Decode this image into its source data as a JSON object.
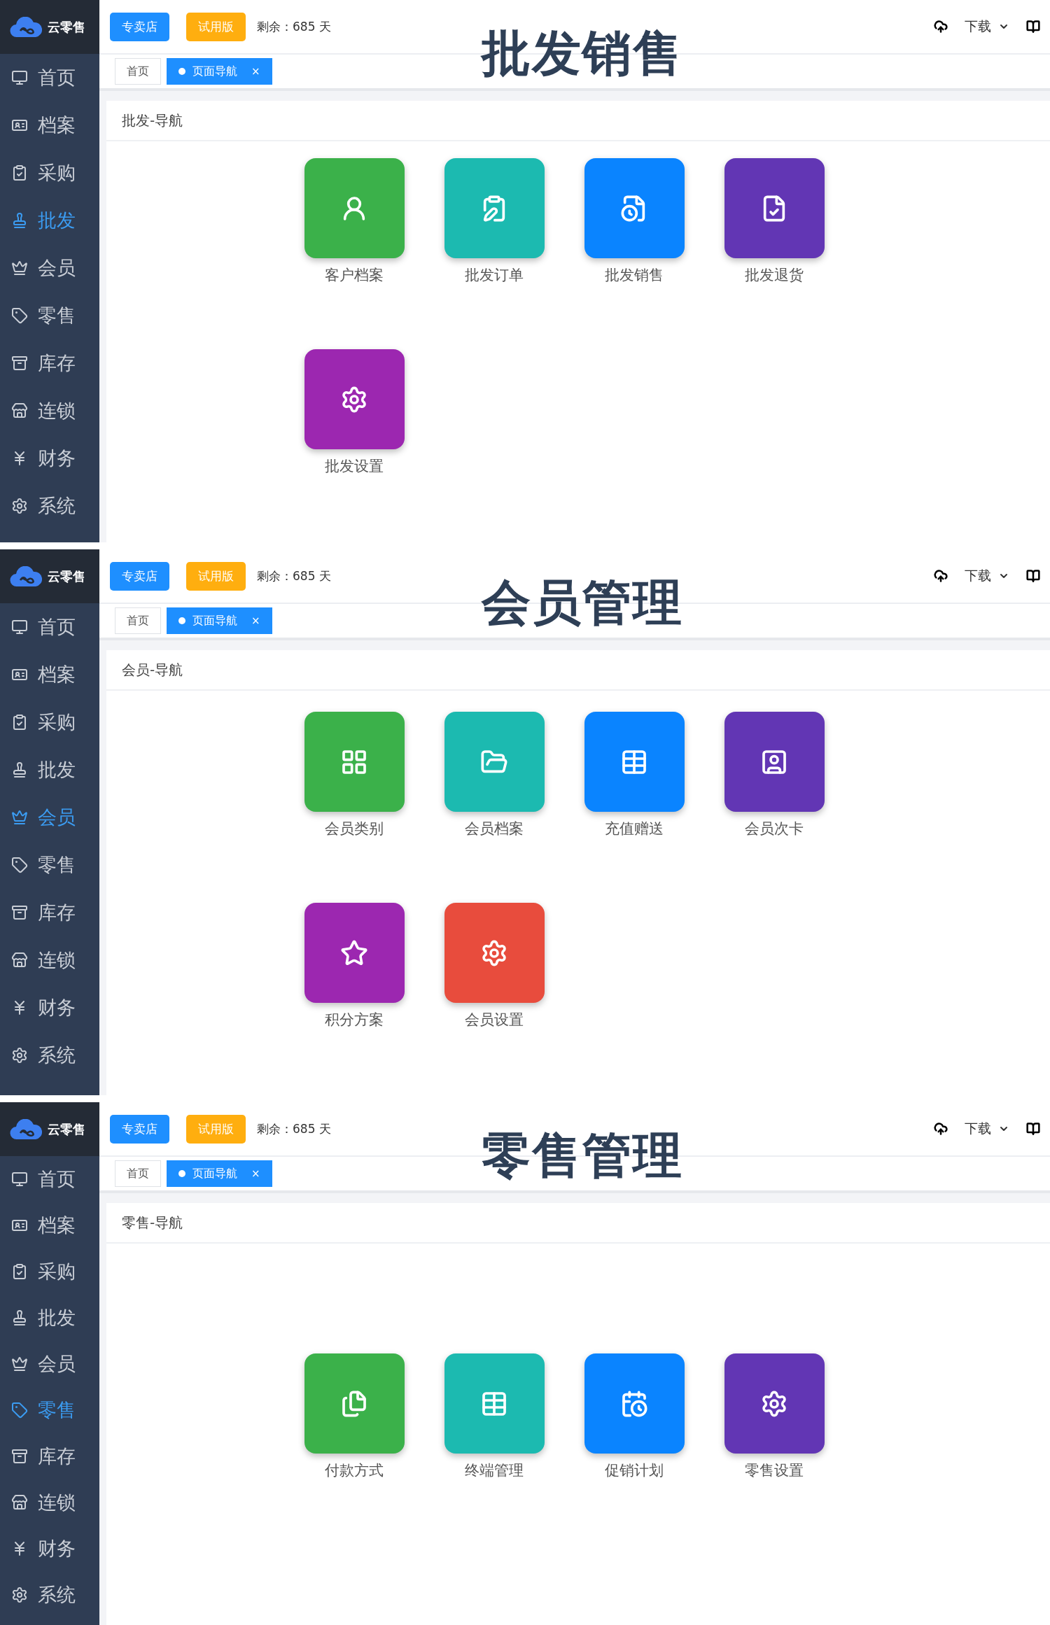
{
  "panels": [
    {
      "overlay_title": "批发销售",
      "logo": "云零售",
      "badges": [
        {
          "label": "专卖店",
          "color": "#1e8fff"
        },
        {
          "label": "试用版",
          "color": "#ffae0f"
        }
      ],
      "remaining": "剩余：685 天",
      "download": "下载",
      "tabs": [
        {
          "label": "首页",
          "selected": false
        },
        {
          "label": "页面导航",
          "selected": true,
          "close": "×"
        }
      ],
      "sidebar": [
        {
          "label": "首页",
          "selected": false
        },
        {
          "label": "档案",
          "selected": false
        },
        {
          "label": "采购",
          "selected": false
        },
        {
          "label": "批发",
          "selected": true
        },
        {
          "label": "会员",
          "selected": false
        },
        {
          "label": "零售",
          "selected": false
        },
        {
          "label": "库存",
          "selected": false
        },
        {
          "label": "连锁",
          "selected": false
        },
        {
          "label": "财务",
          "selected": false
        },
        {
          "label": "系统",
          "selected": false
        }
      ],
      "section_title": "批发-导航",
      "tiles": [
        {
          "label": "客户档案",
          "color": "#3bb14a"
        },
        {
          "label": "批发订单",
          "color": "#1cbab0"
        },
        {
          "label": "批发销售",
          "color": "#0a84ff"
        },
        {
          "label": "批发退货",
          "color": "#6236b4"
        },
        {
          "label": "批发设置",
          "color": "#9c27b0"
        }
      ]
    },
    {
      "overlay_title": "会员管理",
      "logo": "云零售",
      "badges": [
        {
          "label": "专卖店",
          "color": "#1e8fff"
        },
        {
          "label": "试用版",
          "color": "#ffae0f"
        }
      ],
      "remaining": "剩余：685 天",
      "download": "下载",
      "tabs": [
        {
          "label": "首页",
          "selected": false
        },
        {
          "label": "页面导航",
          "selected": true,
          "close": "×"
        }
      ],
      "sidebar": [
        {
          "label": "首页",
          "selected": false
        },
        {
          "label": "档案",
          "selected": false
        },
        {
          "label": "采购",
          "selected": false
        },
        {
          "label": "批发",
          "selected": false
        },
        {
          "label": "会员",
          "selected": true
        },
        {
          "label": "零售",
          "selected": false
        },
        {
          "label": "库存",
          "selected": false
        },
        {
          "label": "连锁",
          "selected": false
        },
        {
          "label": "财务",
          "selected": false
        },
        {
          "label": "系统",
          "selected": false
        }
      ],
      "section_title": "会员-导航",
      "tiles": [
        {
          "label": "会员类别",
          "color": "#3bb14a"
        },
        {
          "label": "会员档案",
          "color": "#1cbab0"
        },
        {
          "label": "充值赠送",
          "color": "#0a84ff"
        },
        {
          "label": "会员次卡",
          "color": "#6236b4"
        },
        {
          "label": "积分方案",
          "color": "#9c27b0"
        },
        {
          "label": "会员设置",
          "color": "#e84c3d"
        }
      ]
    },
    {
      "overlay_title": "零售管理",
      "logo": "云零售",
      "badges": [
        {
          "label": "专卖店",
          "color": "#1e8fff"
        },
        {
          "label": "试用版",
          "color": "#ffae0f"
        }
      ],
      "remaining": "剩余：685 天",
      "download": "下载",
      "tabs": [
        {
          "label": "首页",
          "selected": false
        },
        {
          "label": "页面导航",
          "selected": true,
          "close": "×"
        }
      ],
      "sidebar": [
        {
          "label": "首页",
          "selected": false
        },
        {
          "label": "档案",
          "selected": false
        },
        {
          "label": "采购",
          "selected": false
        },
        {
          "label": "批发",
          "selected": false
        },
        {
          "label": "会员",
          "selected": false
        },
        {
          "label": "零售",
          "selected": true
        },
        {
          "label": "库存",
          "selected": false
        },
        {
          "label": "连锁",
          "selected": false
        },
        {
          "label": "财务",
          "selected": false
        },
        {
          "label": "系统",
          "selected": false
        }
      ],
      "section_title": "零售-导航",
      "tiles": [
        {
          "label": "付款方式",
          "color": "#3bb14a"
        },
        {
          "label": "终端管理",
          "color": "#1cbab0"
        },
        {
          "label": "促销计划",
          "color": "#0a84ff"
        },
        {
          "label": "零售设置",
          "color": "#6236b4"
        }
      ]
    }
  ]
}
